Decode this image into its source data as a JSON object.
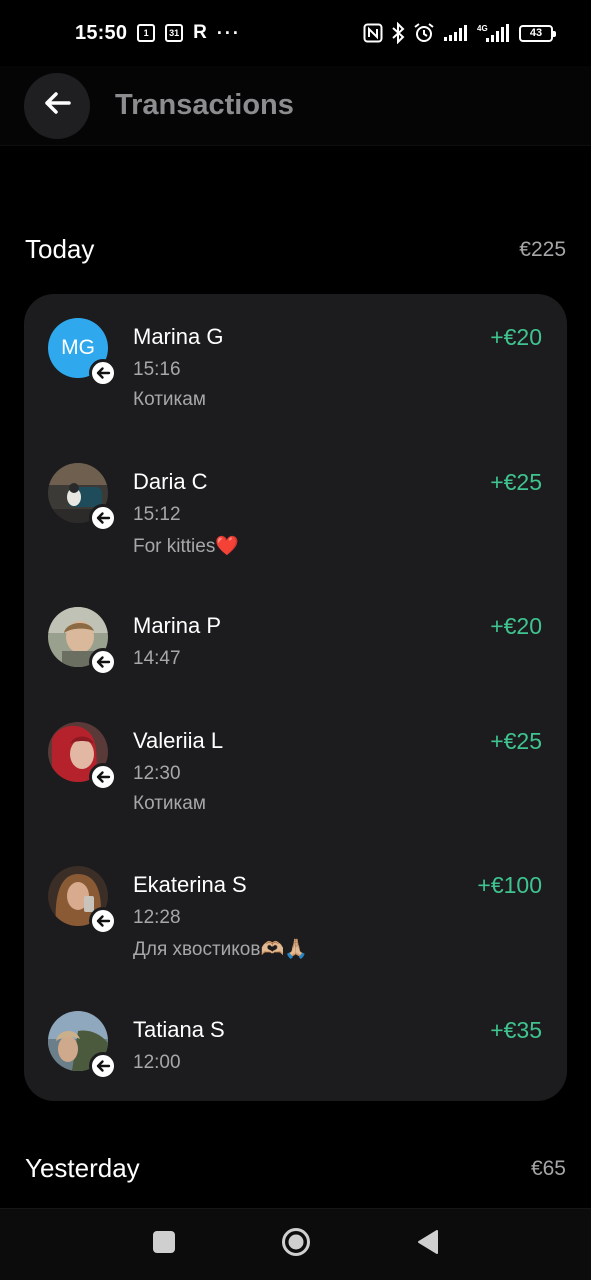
{
  "status_bar": {
    "time": "15:50",
    "notif_box_1": "1",
    "notif_box_2": "31",
    "notif_r": "R",
    "more": "···",
    "network": "4G",
    "battery": "43"
  },
  "header": {
    "title": "Transactions",
    "back_icon": "arrow-left-icon"
  },
  "sections": [
    {
      "title": "Today",
      "total": "€225",
      "transactions": [
        {
          "name": "Marina G",
          "time": "15:16",
          "note": "Котикам",
          "amount": "+€20",
          "avatar_initials": "MG",
          "direction_icon": "incoming-arrow-icon"
        },
        {
          "name": "Daria C",
          "time": "15:12",
          "note": "For kitties❤️",
          "amount": "+€25",
          "direction_icon": "incoming-arrow-icon"
        },
        {
          "name": "Marina P",
          "time": "14:47",
          "note": "",
          "amount": "+€20",
          "direction_icon": "incoming-arrow-icon"
        },
        {
          "name": "Valeriia L",
          "time": "12:30",
          "note": "Котикам",
          "amount": "+€25",
          "direction_icon": "incoming-arrow-icon"
        },
        {
          "name": "Ekaterina S",
          "time": "12:28",
          "note": "Для хвостиков🫶🏼🙏🏼",
          "amount": "+€100",
          "direction_icon": "incoming-arrow-icon"
        },
        {
          "name": "Tatiana S",
          "time": "12:00",
          "note": "",
          "amount": "+€35",
          "direction_icon": "incoming-arrow-icon"
        }
      ]
    },
    {
      "title": "Yesterday",
      "total": "€65"
    }
  ],
  "colors": {
    "background": "#000000",
    "card": "#1c1c1e",
    "amount_positive": "#3fc490",
    "muted_text": "#a7a7a9",
    "avatar_initials_bg": "#2fa8ee"
  },
  "nav": {
    "recents_icon": "square-icon",
    "home_icon": "circle-home-icon",
    "back_icon": "triangle-back-icon"
  }
}
